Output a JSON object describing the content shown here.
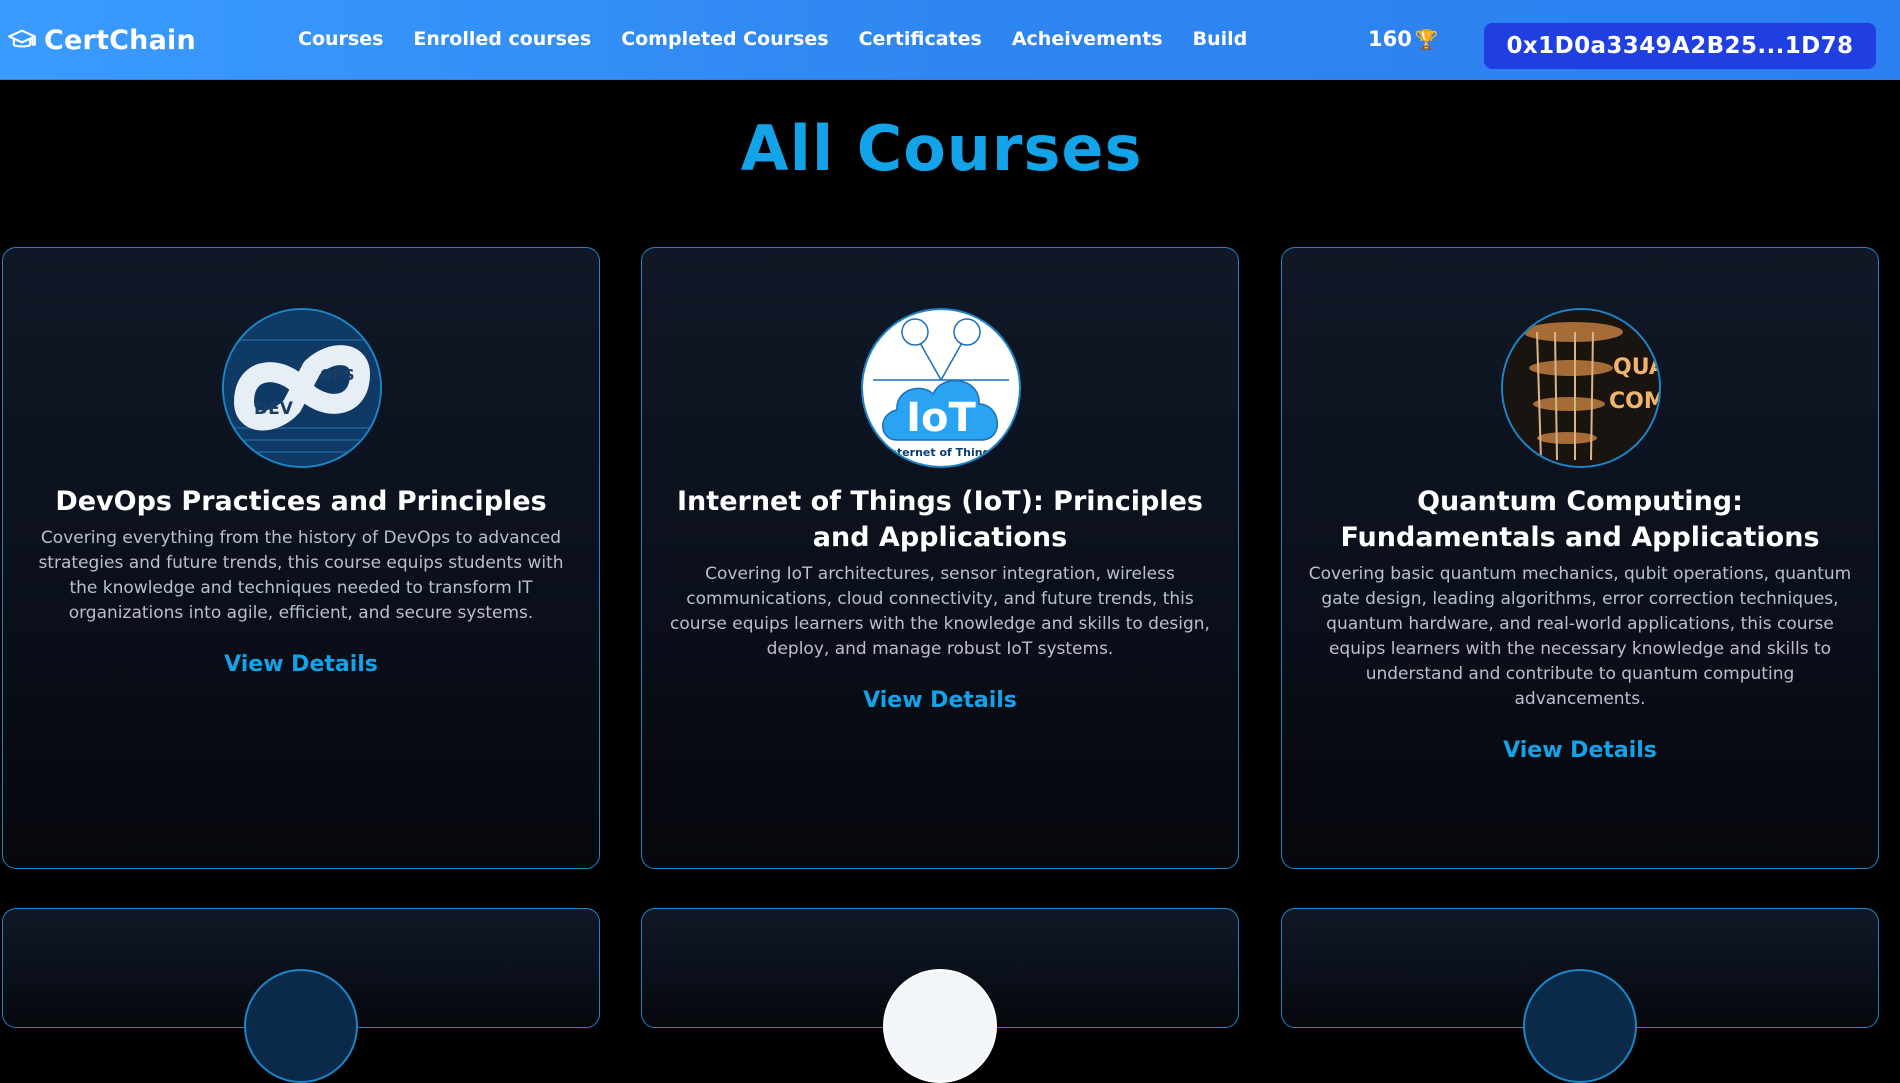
{
  "brand": {
    "name": "CertChain",
    "icon": "graduation-cap-icon"
  },
  "nav": {
    "items": [
      {
        "label": "Courses"
      },
      {
        "label": "Enrolled courses"
      },
      {
        "label": "Completed Courses"
      },
      {
        "label": "Certificates"
      },
      {
        "label": "Acheivements"
      },
      {
        "label": "Build"
      }
    ],
    "points": "160",
    "points_icon": "trophy-icon",
    "wallet": "0x1D0a3349A2B25...1D78"
  },
  "page": {
    "title": "All Courses"
  },
  "courses": [
    {
      "title": "DevOps Practices and Principles",
      "description": "Covering everything from the history of DevOps to advanced strategies and future trends, this course equips students with the knowledge and techniques needed to transform IT organizations into agile, efficient, and secure systems.",
      "link": "View Details",
      "image_text": [
        "DEV",
        "OPS"
      ]
    },
    {
      "title": "Internet of Things (IoT): Principles and Applications",
      "description": "Covering IoT architectures, sensor integration, wireless communications, cloud connectivity, and future trends, this course equips learners with the knowledge and skills to design, deploy, and manage robust IoT systems.",
      "link": "View Details",
      "image_text": [
        "IoT",
        "Internet of Things"
      ]
    },
    {
      "title": "Quantum Computing: Fundamentals and Applications",
      "description": "Covering basic quantum mechanics, qubit operations, quantum gate design, leading algorithms, error correction techniques, quantum hardware, and real-world applications, this course equips learners with the necessary knowledge and skills to understand and contribute to quantum computing advancements.",
      "link": "View Details",
      "image_text": [
        "QUA",
        "COMP"
      ]
    }
  ],
  "colors": {
    "accent": "#12a3e8",
    "nav_gradient_start": "#3a9bff",
    "wallet_button": "#1f3fe0",
    "card_border": "#1a86c8"
  }
}
